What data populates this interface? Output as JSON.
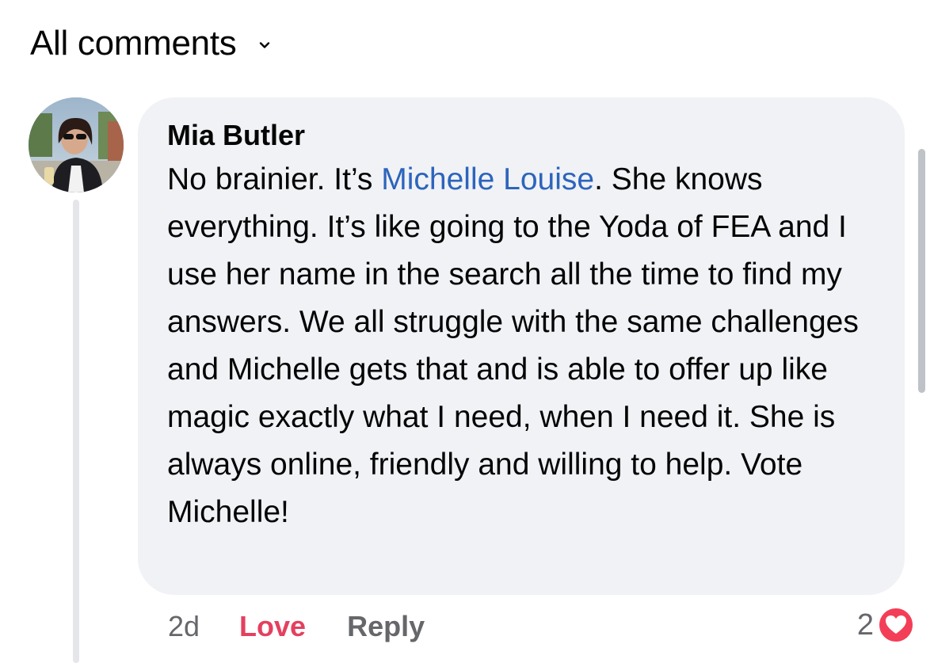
{
  "header": {
    "title": "All comments"
  },
  "comment": {
    "author": "Mia Butler",
    "text_before": "No brainier. It’s ",
    "mention": "Michelle Louise",
    "text_after": ". She knows everything. It’s like going to the Yoda of FEA and I use her name in the search all the time to find my answers. We all struggle with the same challenges and Michelle gets that and is able to offer up like magic exactly what I need, when I need it. She is always online, friendly and willing to help. Vote Michelle!",
    "time": "2d",
    "love_label": "Love",
    "reply_label": "Reply",
    "reaction_count": "2"
  },
  "colors": {
    "bubble_bg": "#f0f2f5",
    "mention": "#2d64bc",
    "love": "#e4405f",
    "muted": "#65676b"
  }
}
